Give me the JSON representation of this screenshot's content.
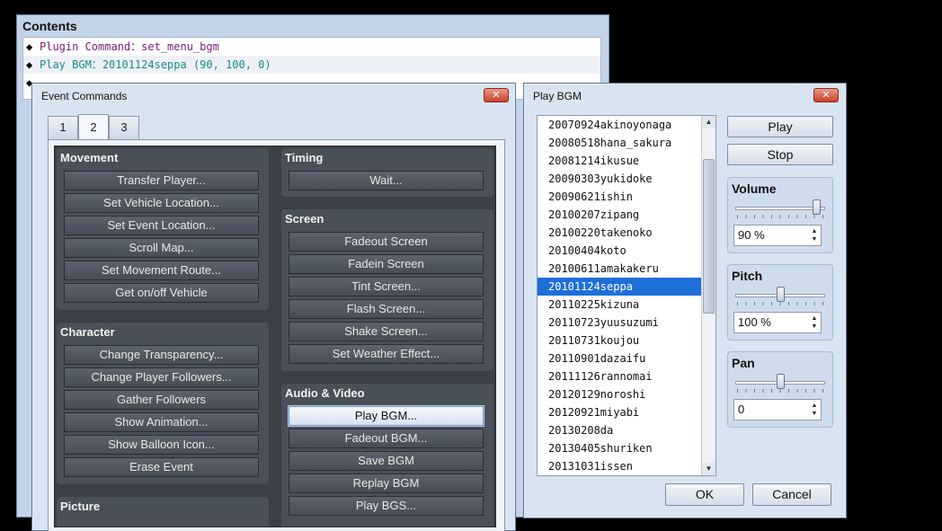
{
  "contents": {
    "title": "Contents",
    "rows": [
      {
        "label": "Plugin Command：",
        "arg": "set_menu_bgm",
        "type": "plugin"
      },
      {
        "label": "Play BGM：",
        "arg": "20101124seppa (90, 100, 0)",
        "type": "bgm"
      }
    ]
  },
  "event_commands": {
    "title": "Event Commands",
    "close_label": "✕",
    "tabs": [
      {
        "label": "1"
      },
      {
        "label": "2"
      },
      {
        "label": "3"
      }
    ],
    "active_tab": "2",
    "groups": {
      "movement": {
        "title": "Movement",
        "buttons": [
          "Transfer Player...",
          "Set Vehicle Location...",
          "Set Event Location...",
          "Scroll Map...",
          "Set Movement Route...",
          "Get on/off Vehicle"
        ]
      },
      "character": {
        "title": "Character",
        "buttons": [
          "Change Transparency...",
          "Change Player Followers...",
          "Gather Followers",
          "Show Animation...",
          "Show Balloon Icon...",
          "Erase Event"
        ]
      },
      "picture": {
        "title": "Picture",
        "buttons": []
      },
      "timing": {
        "title": "Timing",
        "buttons": [
          "Wait..."
        ]
      },
      "screen": {
        "title": "Screen",
        "buttons": [
          "Fadeout Screen",
          "Fadein Screen",
          "Tint Screen...",
          "Flash Screen...",
          "Shake Screen...",
          "Set Weather Effect..."
        ]
      },
      "audio_video": {
        "title": "Audio & Video",
        "buttons": [
          "Play BGM...",
          "Fadeout BGM...",
          "Save BGM",
          "Replay BGM",
          "Play BGS..."
        ],
        "selected": "Play BGM..."
      }
    }
  },
  "play_bgm": {
    "title": "Play BGM",
    "close_label": "✕",
    "list": [
      "20070924akinoyonaga",
      "20080518hana_sakura",
      "20081214ikusue",
      "20090303yukidoke",
      "20090621ishin",
      "20100207zipang",
      "20100220takenoko",
      "20100404koto",
      "20100611amakakeru",
      "20101124seppa",
      "20110225kizuna",
      "20110723yuusuzumi",
      "20110731koujou",
      "20110901dazaifu",
      "20111126rannomai",
      "20120129noroshi",
      "20120921miyabi",
      "20130208da",
      "20130405shuriken",
      "20131031issen"
    ],
    "selected": "20101124seppa",
    "play_label": "Play",
    "stop_label": "Stop",
    "volume": {
      "title": "Volume",
      "value_text": "90 %",
      "value": 90,
      "min": 0,
      "max": 100
    },
    "pitch": {
      "title": "Pitch",
      "value_text": "100 %",
      "value": 100,
      "min": 50,
      "max": 150
    },
    "pan": {
      "title": "Pan",
      "value_text": "0",
      "value": 0,
      "min": -100,
      "max": 100
    },
    "ok_label": "OK",
    "cancel_label": "Cancel"
  },
  "colors": {
    "selected_row": "#1f6fd8",
    "panel_dark": "#3b4047",
    "close_red": "#c8412b"
  }
}
